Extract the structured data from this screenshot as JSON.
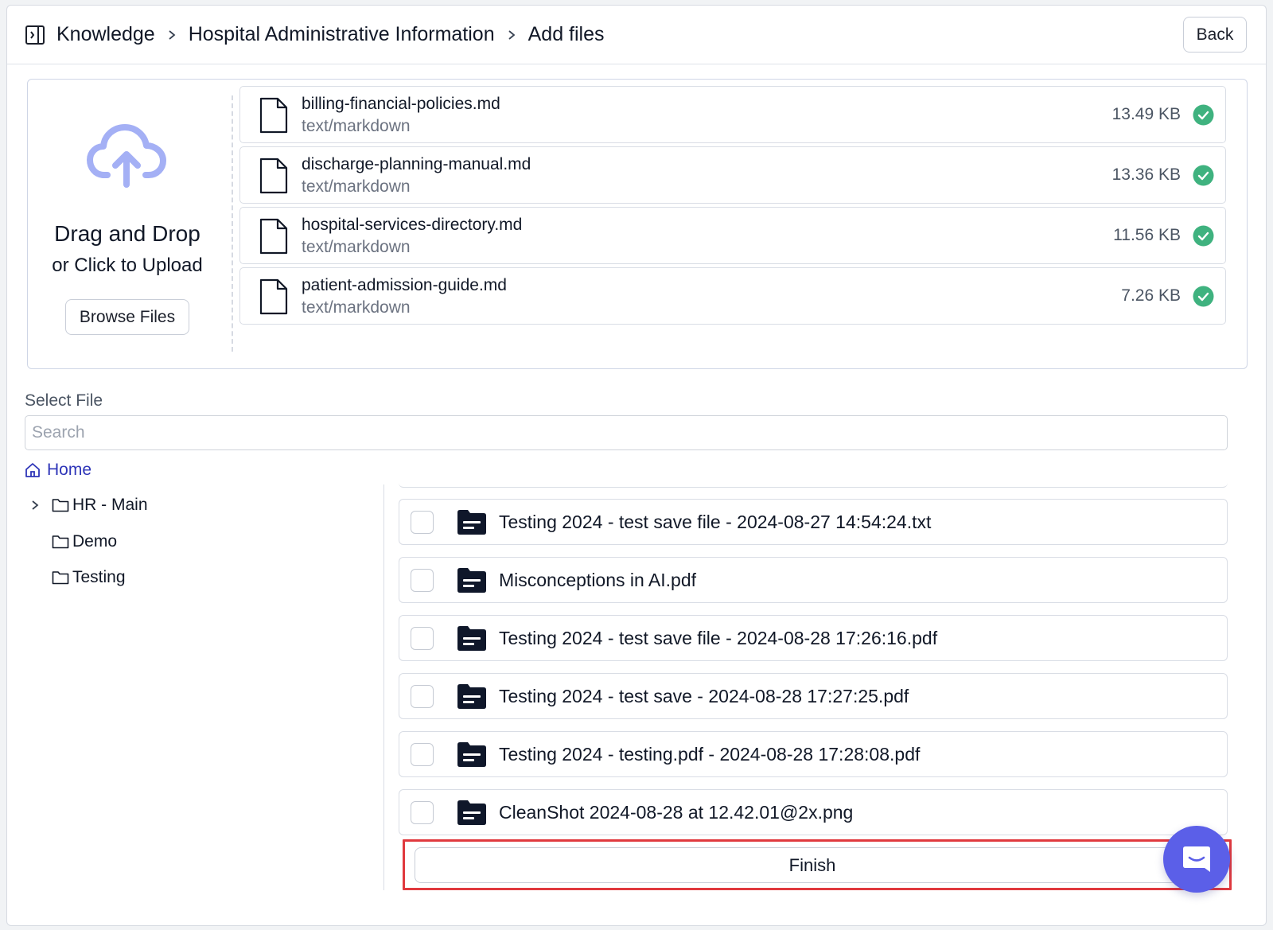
{
  "header": {
    "breadcrumb": [
      "Knowledge",
      "Hospital Administrative Information",
      "Add files"
    ],
    "back_label": "Back"
  },
  "upload": {
    "title": "Drag and Drop",
    "subtitle": "or Click to Upload",
    "browse_label": "Browse Files",
    "files": [
      {
        "name": "billing-financial-policies.md",
        "type": "text/markdown",
        "size": "13.49 KB"
      },
      {
        "name": "discharge-planning-manual.md",
        "type": "text/markdown",
        "size": "13.36 KB"
      },
      {
        "name": "hospital-services-directory.md",
        "type": "text/markdown",
        "size": "11.56 KB"
      },
      {
        "name": "patient-admission-guide.md",
        "type": "text/markdown",
        "size": "7.26 KB"
      }
    ]
  },
  "select_file": {
    "label": "Select File",
    "search_placeholder": "Search",
    "tree": {
      "home": "Home",
      "folders": [
        "HR - Main",
        "Demo",
        "Testing"
      ]
    },
    "documents": [
      "Testing 2024 - test save file - 2024-08-27 14:54:24.txt",
      "Misconceptions in AI.pdf",
      "Testing 2024 - test save file - 2024-08-28 17:26:16.pdf",
      "Testing 2024 - test save - 2024-08-28 17:27:25.pdf",
      "Testing 2024 - testing.pdf - 2024-08-28 17:28:08.pdf",
      "CleanShot 2024-08-28 at 12.42.01@2x.png"
    ]
  },
  "finish_label": "Finish",
  "colors": {
    "accent": "#5b5fe8",
    "link": "#2e35b8",
    "success": "#3fb27f",
    "highlight": "#e0393e",
    "cloud": "#a4b0f5"
  },
  "icons": [
    "sidebar-toggle-icon",
    "chevron-right-icon",
    "cloud-upload-icon",
    "file-icon",
    "check-circle-icon",
    "home-icon",
    "folder-icon",
    "document-folder-icon",
    "chat-icon"
  ]
}
